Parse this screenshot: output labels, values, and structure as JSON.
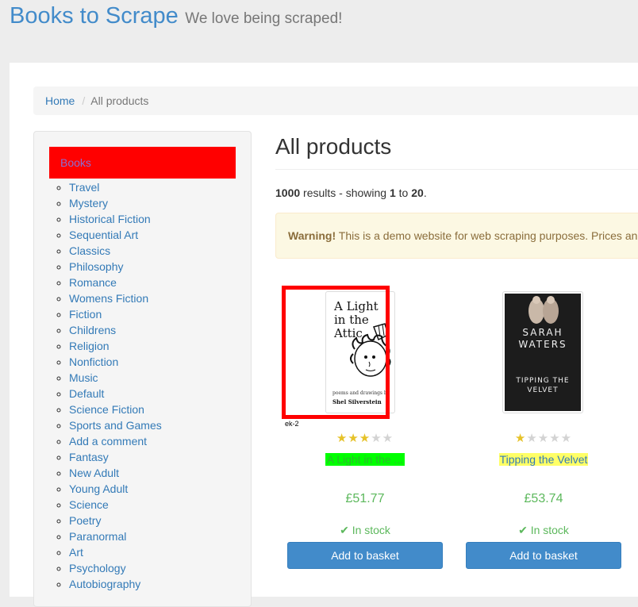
{
  "header": {
    "brand": "Books to Scrape",
    "tagline": "We love being scraped!"
  },
  "breadcrumb": {
    "home": "Home",
    "separator": "/",
    "current": "All products"
  },
  "sidebar": {
    "heading": "Books",
    "heading_bg": "#ff0000",
    "categories": [
      "Travel",
      "Mystery",
      "Historical Fiction",
      "Sequential Art",
      "Classics",
      "Philosophy",
      "Romance",
      "Womens Fiction",
      "Fiction",
      "Childrens",
      "Religion",
      "Nonfiction",
      "Music",
      "Default",
      "Science Fiction",
      "Sports and Games",
      "Add a comment",
      "Fantasy",
      "New Adult",
      "Young Adult",
      "Science",
      "Poetry",
      "Paranormal",
      "Art",
      "Psychology",
      "Autobiography"
    ]
  },
  "main": {
    "title": "All products",
    "results": {
      "count": "1000",
      "text1": " results - showing ",
      "from": "1",
      "text2": " to ",
      "to": "20",
      "end": "."
    },
    "warning": {
      "strong": "Warning!",
      "text": " This is a demo website for web scraping purposes. Prices and ratings here were randomly assigned"
    }
  },
  "products": [
    {
      "title": "A Light in the ...",
      "rating": 3,
      "price": "£51.77",
      "stock": "In stock",
      "button": "Add to basket",
      "cover_title": "A Light in the Attic",
      "cover_subtitle": "poems and drawings by",
      "cover_author": "Shel Silverstein",
      "highlight_color": "#00ff00",
      "overlay_label": "ek-2"
    },
    {
      "title": "Tipping the Velvet",
      "rating": 1,
      "price": "£53.74",
      "stock": "In stock",
      "button": "Add to basket",
      "cover_author": "SARAH WATERS",
      "cover_title": "TIPPING THE VELVET",
      "highlight_color": "#ffff66"
    }
  ]
}
